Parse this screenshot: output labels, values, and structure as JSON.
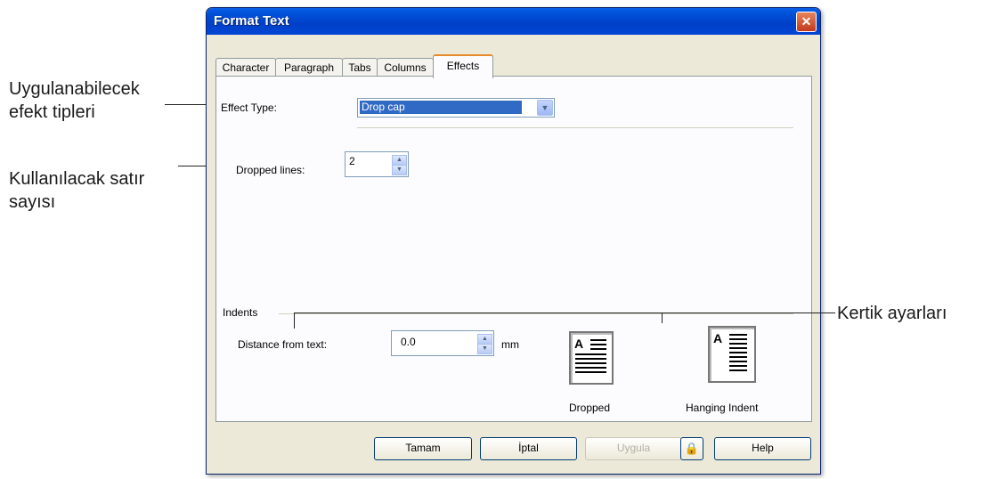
{
  "callouts": {
    "effect_type": [
      "Uygulanabilecek",
      "efekt tipleri"
    ],
    "dropped_lines": [
      "Kullanılacak satır",
      "sayısı"
    ],
    "indents": "Kertik ayarları"
  },
  "window": {
    "title": "Format Text",
    "close_icon": "close-icon"
  },
  "tabs": [
    {
      "label": "Character"
    },
    {
      "label": "Paragraph"
    },
    {
      "label": "Tabs"
    },
    {
      "label": "Columns"
    },
    {
      "label": "Effects",
      "active": true
    }
  ],
  "effects": {
    "effect_type_label": "Effect Type:",
    "effect_type_value": "Drop cap",
    "dropped_lines_label": "Dropped lines:",
    "dropped_lines_value": "2",
    "indents_label": "Indents",
    "distance_label": "Distance from text:",
    "distance_value": "0.0",
    "distance_unit": "mm",
    "preview_dropped_label": "Dropped",
    "preview_hanging_label": "Hanging Indent",
    "preview_cap": "A"
  },
  "buttons": {
    "ok": "Tamam",
    "cancel": "İptal",
    "apply": "Uygula",
    "lock_icon": "lock-icon",
    "help": "Help"
  },
  "colors": {
    "titlebar": "#0052d9",
    "selection": "#316ac5",
    "active_tab_accent": "#e68b2c"
  }
}
